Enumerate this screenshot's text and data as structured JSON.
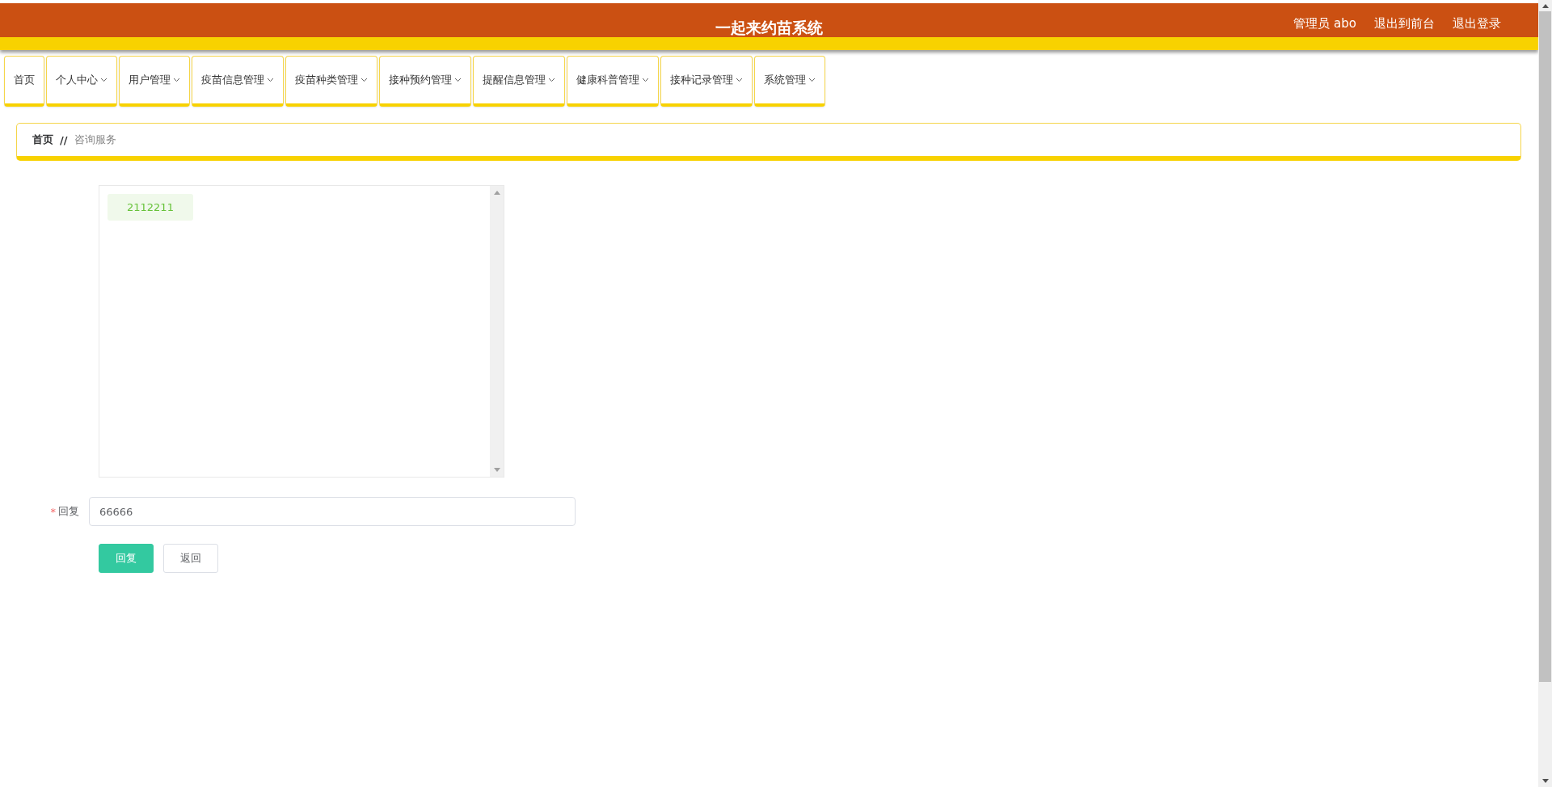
{
  "header": {
    "title": "一起来约苗系统",
    "links": [
      "管理员 abo",
      "退出到前台",
      "退出登录"
    ]
  },
  "nav": [
    {
      "label": "首页",
      "dropdown": false
    },
    {
      "label": "个人中心",
      "dropdown": true
    },
    {
      "label": "用户管理",
      "dropdown": true
    },
    {
      "label": "疫苗信息管理",
      "dropdown": true
    },
    {
      "label": "疫苗种类管理",
      "dropdown": true
    },
    {
      "label": "接种预约管理",
      "dropdown": true
    },
    {
      "label": "提醒信息管理",
      "dropdown": true
    },
    {
      "label": "健康科普管理",
      "dropdown": true
    },
    {
      "label": "接种记录管理",
      "dropdown": true
    },
    {
      "label": "系统管理",
      "dropdown": true
    }
  ],
  "breadcrumb": {
    "home": "首页",
    "separator": "//",
    "current": "咨询服务"
  },
  "chat": {
    "messages": [
      "2112211"
    ]
  },
  "form": {
    "required_mark": "*",
    "label": "回复",
    "value": "66666"
  },
  "buttons": [
    {
      "label": "回复",
      "kind": "primary"
    },
    {
      "label": "返回",
      "kind": "default"
    }
  ]
}
